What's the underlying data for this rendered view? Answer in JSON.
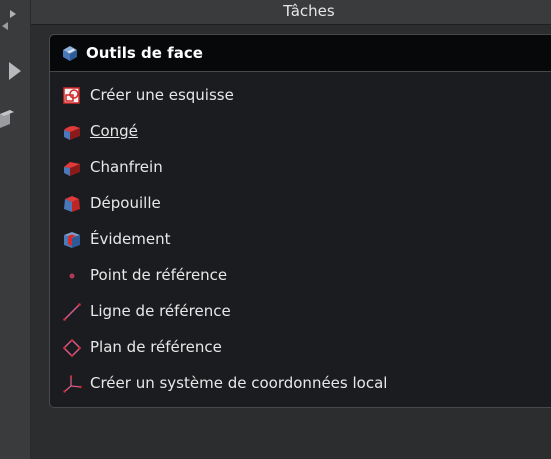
{
  "panel": {
    "title": "Tâches"
  },
  "taskbox": {
    "title": "Outils de face",
    "items": [
      {
        "label": "Créer une esquisse",
        "icon": "sketch-icon",
        "hovered": false
      },
      {
        "label": "Congé",
        "icon": "fillet-icon",
        "hovered": true
      },
      {
        "label": "Chanfrein",
        "icon": "chamfer-icon",
        "hovered": false
      },
      {
        "label": "Dépouille",
        "icon": "draft-icon",
        "hovered": false
      },
      {
        "label": "Évidement",
        "icon": "thickness-icon",
        "hovered": false
      },
      {
        "label": "Point de référence",
        "icon": "datum-point-icon",
        "hovered": false
      },
      {
        "label": "Ligne de référence",
        "icon": "datum-line-icon",
        "hovered": false
      },
      {
        "label": "Plan de référence",
        "icon": "datum-plane-icon",
        "hovered": false
      },
      {
        "label": "Créer un système de coordonnées local",
        "icon": "local-coordinate-system-icon",
        "hovered": false
      }
    ]
  },
  "left_toolbar": {
    "icons": [
      "view-cube-corner-icon",
      "play-arrow-icon",
      "box-view-icon"
    ]
  },
  "colors": {
    "background": "#2b2c2e",
    "taskbox_bg": "#1b1c1f",
    "header_bg": "#07080a",
    "text": "#e8e8e8",
    "accent_red": "#d42a2a"
  }
}
